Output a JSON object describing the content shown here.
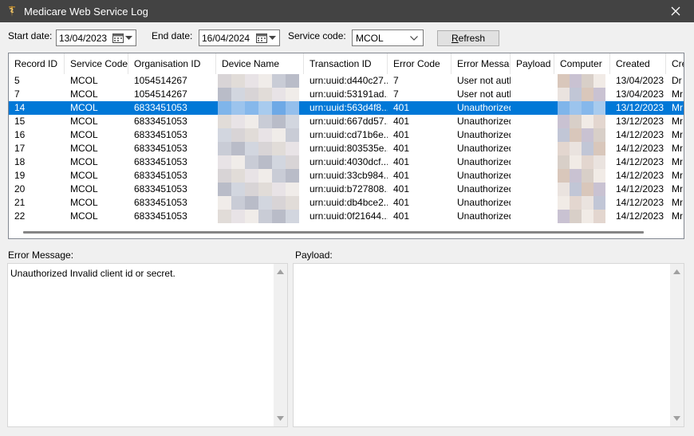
{
  "window": {
    "title": "Medicare Web Service Log"
  },
  "filters": {
    "start_label": "Start date:",
    "start_value": "13/04/2023",
    "end_label": "End date:",
    "end_value": "16/04/2024",
    "service_label": "Service code:",
    "service_value": "MCOL",
    "refresh_label": "Refresh"
  },
  "grid": {
    "columns": [
      "Record ID",
      "Service Code",
      "Organisation ID",
      "Device Name",
      "Transaction ID",
      "Error Code",
      "Error Message",
      "Payload",
      "Computer",
      "Created",
      "Cre"
    ],
    "selected_index": 2,
    "rows": [
      [
        "5",
        "MCOL",
        "1054514267",
        "",
        "urn:uuid:d440c27...",
        "7",
        "User not autho",
        "",
        "",
        "13/04/2023",
        "Dr"
      ],
      [
        "7",
        "MCOL",
        "1054514267",
        "",
        "urn:uuid:53191ad...",
        "7",
        "User not autho",
        "",
        "",
        "13/04/2023",
        "Mr"
      ],
      [
        "14",
        "MCOL",
        "6833451053",
        "",
        "urn:uuid:563d4f8...",
        "401",
        "Unauthorized",
        "",
        "",
        "13/12/2023",
        "Mr"
      ],
      [
        "15",
        "MCOL",
        "6833451053",
        "",
        "urn:uuid:667dd57...",
        "401",
        "Unauthorized",
        "",
        "",
        "13/12/2023",
        "Mr"
      ],
      [
        "16",
        "MCOL",
        "6833451053",
        "",
        "urn:uuid:cd71b6e...",
        "401",
        "Unauthorized",
        "",
        "",
        "14/12/2023",
        "Mr"
      ],
      [
        "17",
        "MCOL",
        "6833451053",
        "",
        "urn:uuid:803535e...",
        "401",
        "Unauthorized",
        "",
        "",
        "14/12/2023",
        "Mr"
      ],
      [
        "18",
        "MCOL",
        "6833451053",
        "",
        "urn:uuid:4030dcf...",
        "401",
        "Unauthorized",
        "",
        "",
        "14/12/2023",
        "Mr"
      ],
      [
        "19",
        "MCOL",
        "6833451053",
        "",
        "urn:uuid:33cb984...",
        "401",
        "Unauthorized",
        "",
        "",
        "14/12/2023",
        "Mr"
      ],
      [
        "20",
        "MCOL",
        "6833451053",
        "",
        "urn:uuid:b727808...",
        "401",
        "Unauthorized",
        "",
        "",
        "14/12/2023",
        "Mr"
      ],
      [
        "21",
        "MCOL",
        "6833451053",
        "",
        "urn:uuid:db4bce2...",
        "401",
        "Unauthorized",
        "",
        "",
        "14/12/2023",
        "Mr"
      ],
      [
        "22",
        "MCOL",
        "6833451053",
        "",
        "urn:uuid:0f21644...",
        "401",
        "Unauthorized",
        "",
        "",
        "14/12/2023",
        "Mr"
      ]
    ]
  },
  "details": {
    "error_label": "Error Message:",
    "error_text": "Unauthorized Invalid client id or secret.",
    "payload_label": "Payload:",
    "payload_text": ""
  },
  "colors": {
    "selection": "#0078d7",
    "titlebar": "#434343"
  }
}
